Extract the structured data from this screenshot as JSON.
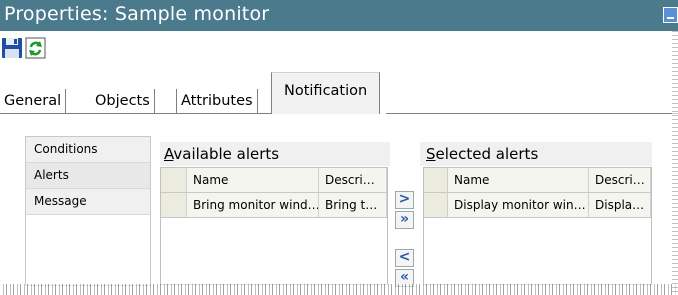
{
  "window": {
    "title": "Properties: Sample monitor"
  },
  "toolbar": {
    "save_icon": "floppy-disk-save-icon",
    "refresh_icon": "refresh-arrows-icon"
  },
  "tabs": [
    {
      "label": "General",
      "active": false
    },
    {
      "label": "Objects",
      "active": false
    },
    {
      "label": "Attributes",
      "active": false
    },
    {
      "label": "Notification",
      "active": true
    }
  ],
  "sidebar": {
    "items": [
      {
        "label": "Conditions",
        "selected": false
      },
      {
        "label": "Alerts",
        "selected": true
      },
      {
        "label": "Message",
        "selected": false
      }
    ]
  },
  "available_alerts": {
    "title_prefix": "A",
    "title_rest": "vailable alerts",
    "columns": [
      "Name",
      "Descri…"
    ],
    "rows": [
      {
        "name": "Bring monitor wind…",
        "description": "Bring t…"
      }
    ]
  },
  "selected_alerts": {
    "title_prefix": "S",
    "title_rest": "elected alerts",
    "columns": [
      "Name",
      "Descri…"
    ],
    "rows": [
      {
        "name": "Display monitor win…",
        "description": "Displa…"
      }
    ]
  },
  "move_buttons": {
    "add": ">",
    "add_all": "»",
    "remove": "<",
    "remove_all": "«"
  },
  "colors": {
    "titlebar": "#4a7a8c",
    "arrow_blue": "#2a5aa8"
  }
}
